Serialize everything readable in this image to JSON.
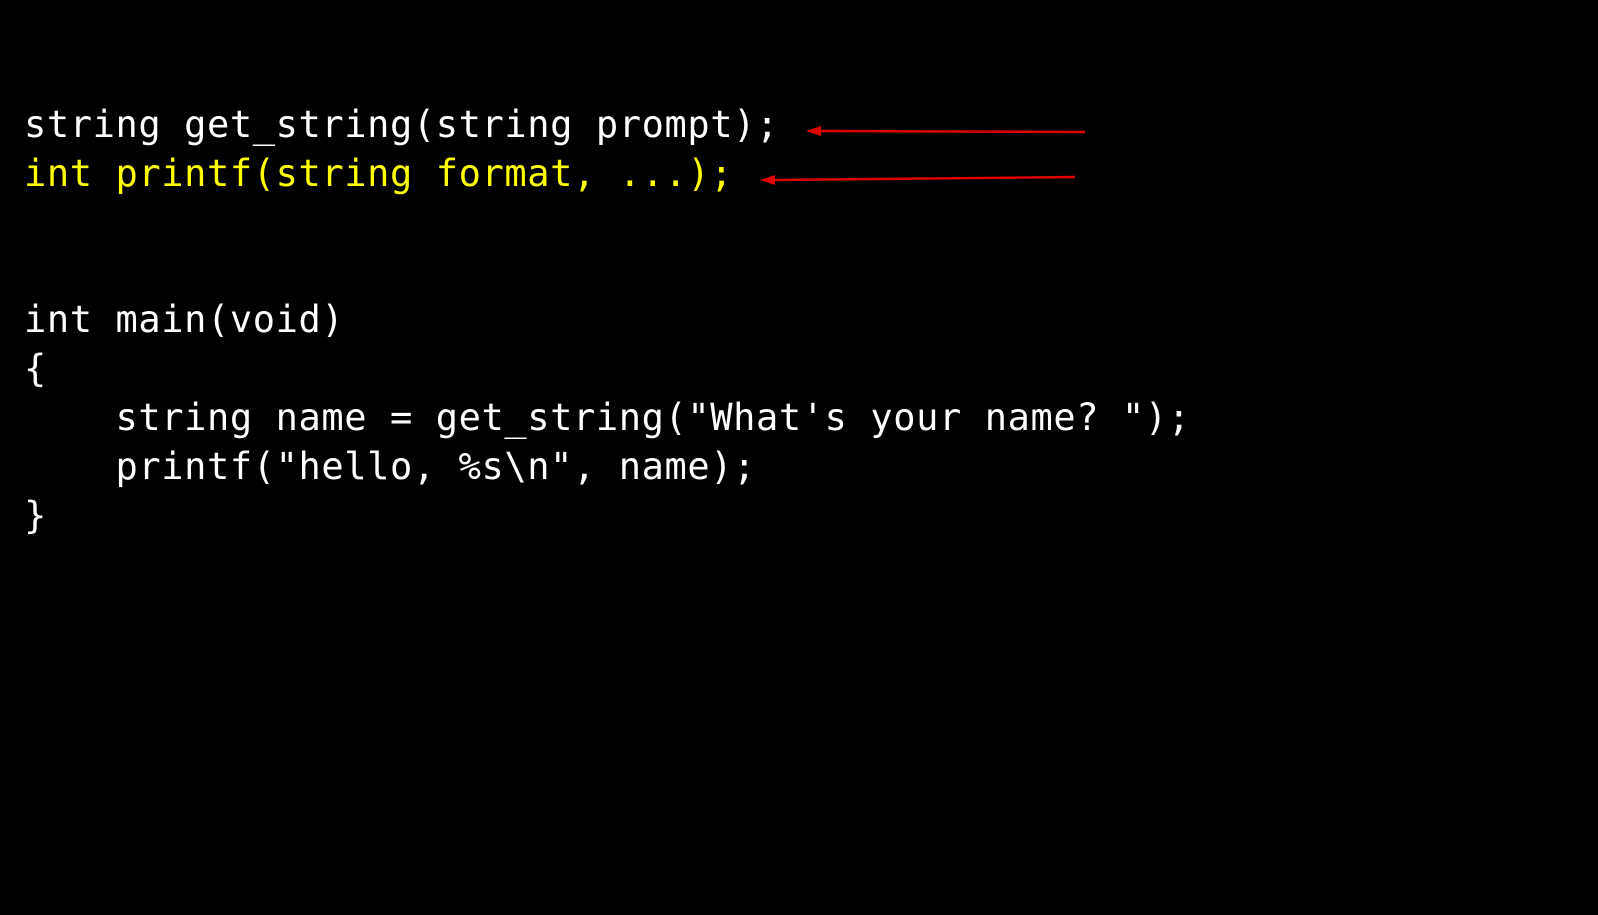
{
  "code": {
    "lines": [
      "string get_string(string prompt);",
      "int printf(string format, ...);",
      "int main(void)",
      "{",
      "    string name = get_string(\"What's your name? \");",
      "    printf(\"hello, %s\\n\", name);",
      "}"
    ],
    "highlighted_line_index": 1
  },
  "colors": {
    "background": "#000000",
    "text": "#ffffff",
    "highlight": "#ffff00",
    "arrow": "#e00000"
  }
}
